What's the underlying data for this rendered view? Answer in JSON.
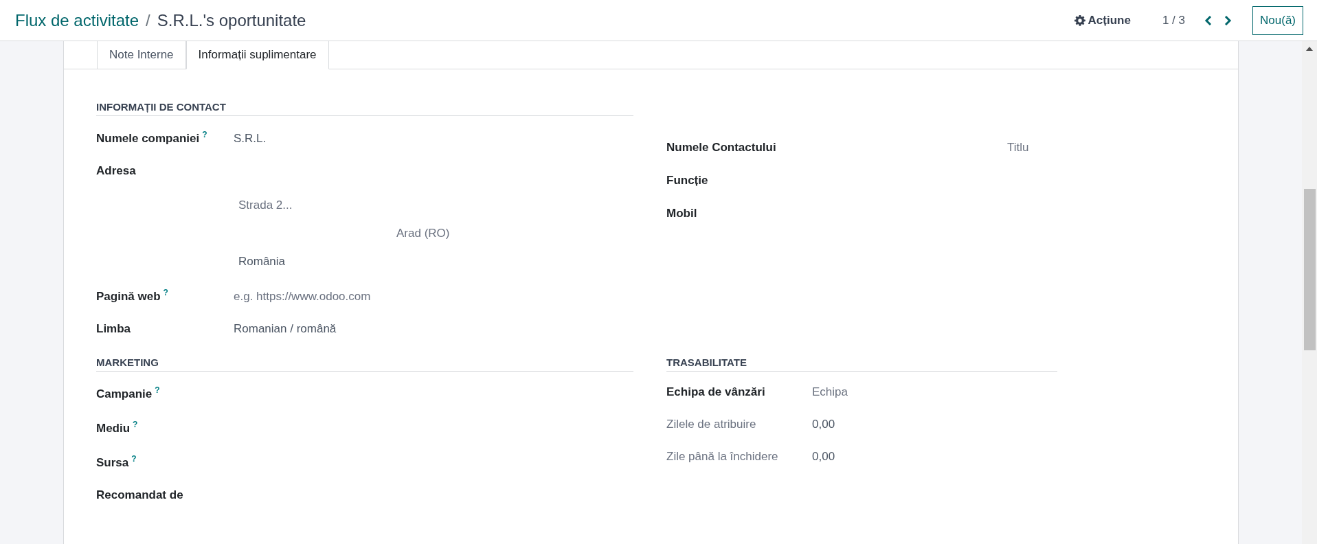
{
  "breadcrumb": {
    "parent": "Flux de activitate",
    "separator": "/",
    "current": "S.R.L.'s oportunitate"
  },
  "actions": {
    "action_label": "Acțiune",
    "pager": "1 / 3",
    "new_button": "Nou(ă)"
  },
  "tabs": [
    {
      "label": "Note Interne",
      "selected": false
    },
    {
      "label": "Informații suplimentare",
      "selected": true
    }
  ],
  "contact_section": {
    "title": "INFORMAȚII DE CONTACT",
    "left": [
      {
        "kind": "field",
        "label": "Numele companiei",
        "help": "?",
        "value": "S.R.L."
      },
      {
        "kind": "address",
        "label": "Adresa",
        "lines": [
          {
            "kind": "street",
            "placeholder": "Strada 2..."
          },
          {
            "kind": "city",
            "placeholder": "Arad (RO)"
          },
          {
            "kind": "country",
            "value": "România"
          }
        ]
      },
      {
        "kind": "field",
        "label": "Pagină web",
        "help": "?",
        "placeholder": "e.g. https://www.odoo.com"
      },
      {
        "kind": "field",
        "label": "Limba",
        "value": "Romanian / română"
      }
    ],
    "right": [
      {
        "label": "Numele Contactului",
        "placeholder": "Titlu"
      },
      {
        "label": "Funcție"
      },
      {
        "label": "Mobil"
      }
    ]
  },
  "marketing_section": {
    "title": "MARKETING",
    "fields": [
      {
        "label": "Campanie",
        "help": "?"
      },
      {
        "label": "Mediu",
        "help": "?"
      },
      {
        "label": "Sursa",
        "help": "?"
      },
      {
        "label": "Recomandat de"
      }
    ]
  },
  "tracking_section": {
    "title": "TRASABILITATE",
    "fields": [
      {
        "label": "Echipa de vânzări",
        "readonly": false,
        "placeholder": "Echipa"
      },
      {
        "label": "Zilele de atribuire",
        "readonly": true,
        "value": "0,00"
      },
      {
        "label": "Zile până la închidere",
        "readonly": true,
        "value": "0,00"
      }
    ]
  }
}
